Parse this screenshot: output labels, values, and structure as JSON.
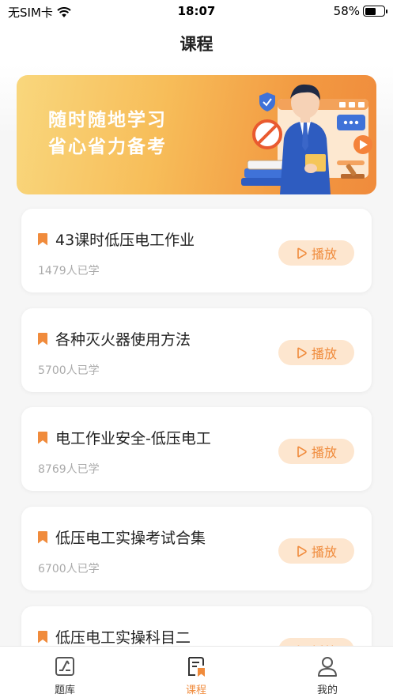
{
  "status_bar": {
    "carrier": "无SIM卡",
    "time": "18:07",
    "battery": "58%",
    "battery_level": 0.58
  },
  "header": {
    "title": "课程"
  },
  "banner": {
    "line1": "随时随地学习",
    "line2": "省心省力备考",
    "colors": {
      "start": "#f9d77d",
      "end": "#f08b3c"
    }
  },
  "courses": [
    {
      "title": "43课时低压电工作业",
      "learners": "1479人已学",
      "action": "播放"
    },
    {
      "title": "各种灭火器使用方法",
      "learners": "5700人已学",
      "action": "播放"
    },
    {
      "title": "电工作业安全-低压电工",
      "learners": "8769人已学",
      "action": "播放"
    },
    {
      "title": "低压电工实操考试合集",
      "learners": "6700人已学",
      "action": "播放"
    },
    {
      "title": "低压电工实操科目二",
      "learners": "",
      "action": "播放"
    }
  ],
  "tabbar": {
    "items": [
      {
        "label": "题库",
        "icon": "question-bank-icon",
        "active": false
      },
      {
        "label": "课程",
        "icon": "course-icon",
        "active": true
      },
      {
        "label": "我的",
        "icon": "profile-icon",
        "active": false
      }
    ],
    "active_color": "#f08b3c"
  }
}
